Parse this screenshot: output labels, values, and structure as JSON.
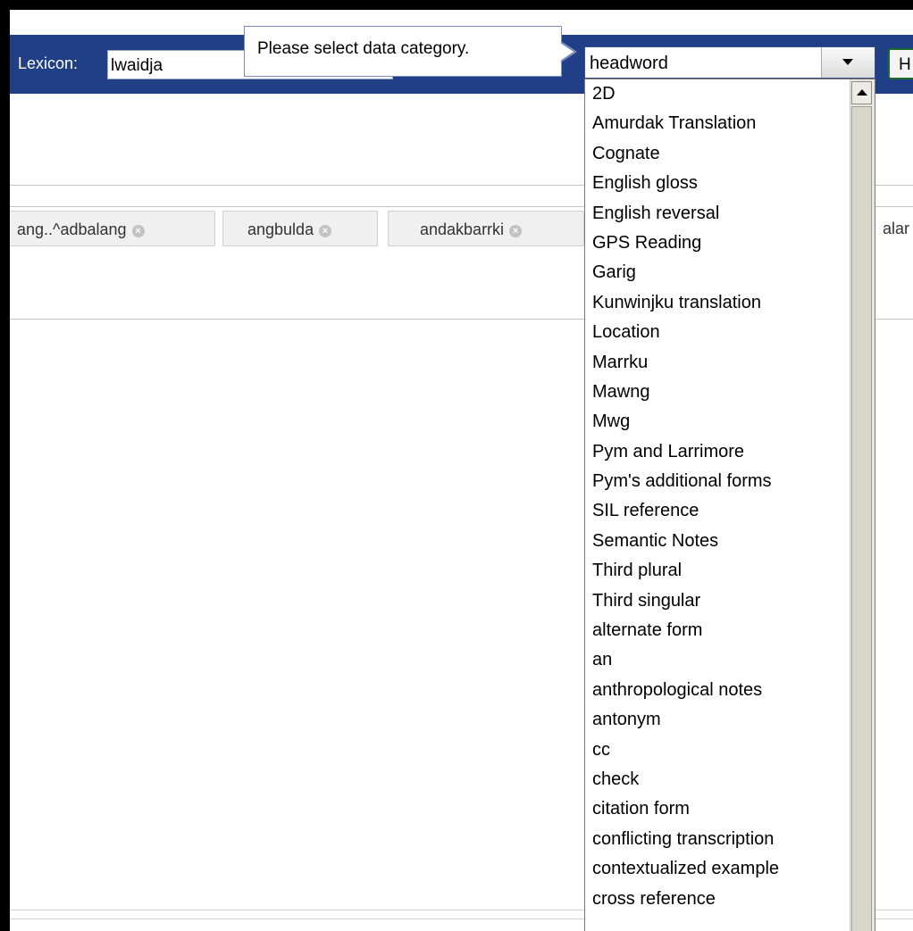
{
  "header": {
    "lexicon_label": "Lexicon:",
    "lexicon_value": "lwaidja",
    "tooltip": "Please select data category.",
    "select_value": "headword",
    "right_button_label": "H"
  },
  "tabs": [
    {
      "label": "ang..^adbalang",
      "close": "×"
    },
    {
      "label": "angbulda",
      "close": "×"
    },
    {
      "label": "andakbarrki",
      "close": "×"
    },
    {
      "label": "alar"
    }
  ],
  "dropdown": {
    "options": [
      "2D",
      "Amurdak Translation",
      "Cognate",
      "English gloss",
      "English reversal",
      "GPS Reading",
      "Garig",
      "Kunwinjku translation",
      "Location",
      "Marrku",
      "Mawng",
      "Mwg",
      "Pym and Larrimore",
      "Pym's additional forms",
      "SIL reference",
      "Semantic Notes",
      "Third plural",
      "Third singular",
      "alternate form",
      "an",
      "anthropological notes",
      "antonym",
      "cc",
      "check",
      "citation form",
      "conflicting transcription",
      "contextualized example",
      "cross reference"
    ]
  },
  "colors": {
    "topbar": "#213f87",
    "frame": "#000000"
  }
}
